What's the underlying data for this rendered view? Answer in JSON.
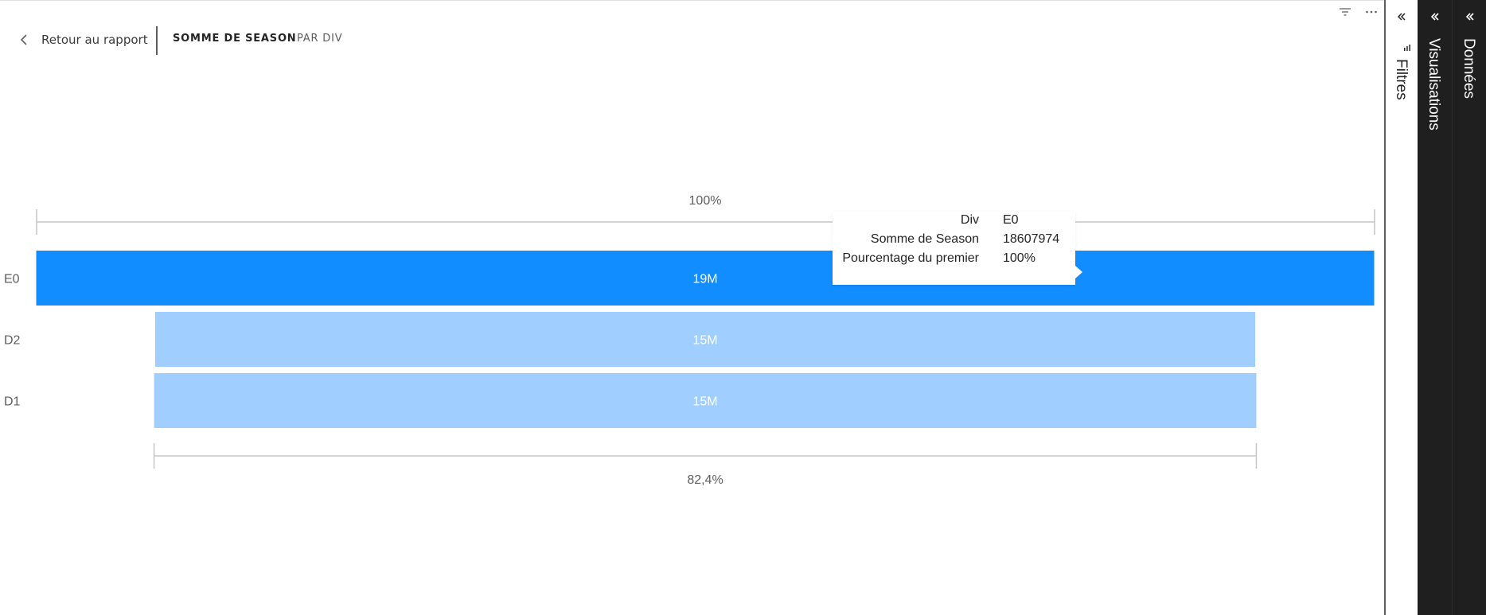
{
  "header": {
    "back_label": "Retour au rapport",
    "breadcrumb": [
      "SOMME DE SEASON",
      "PAR DIV"
    ],
    "icons": [
      "back-chevron-icon",
      "filter-icon",
      "more-options-icon"
    ]
  },
  "chart_data": {
    "type": "funnel",
    "categories": [
      "E0",
      "D2",
      "D1"
    ],
    "values": [
      18607974,
      15300000,
      15330000
    ],
    "data_labels": [
      "19M",
      "15M",
      "15M"
    ],
    "top_percent_label": "100%",
    "bottom_percent_label": "82,4%",
    "colors": {
      "highlight": "#118dff",
      "normal": "#a0cfff"
    },
    "highlighted_category": "E0"
  },
  "tooltip": {
    "rows": [
      {
        "label": "Div",
        "value": "E0"
      },
      {
        "label": "Somme de Season",
        "value": "18607974"
      },
      {
        "label": "Pourcentage du premier",
        "value": "100%"
      }
    ]
  },
  "panes": {
    "filters": {
      "label": "Filtres",
      "icon": "filter-pane-icon"
    },
    "visualizations": {
      "label": "Visualisations"
    },
    "data": {
      "label": "Données"
    }
  }
}
